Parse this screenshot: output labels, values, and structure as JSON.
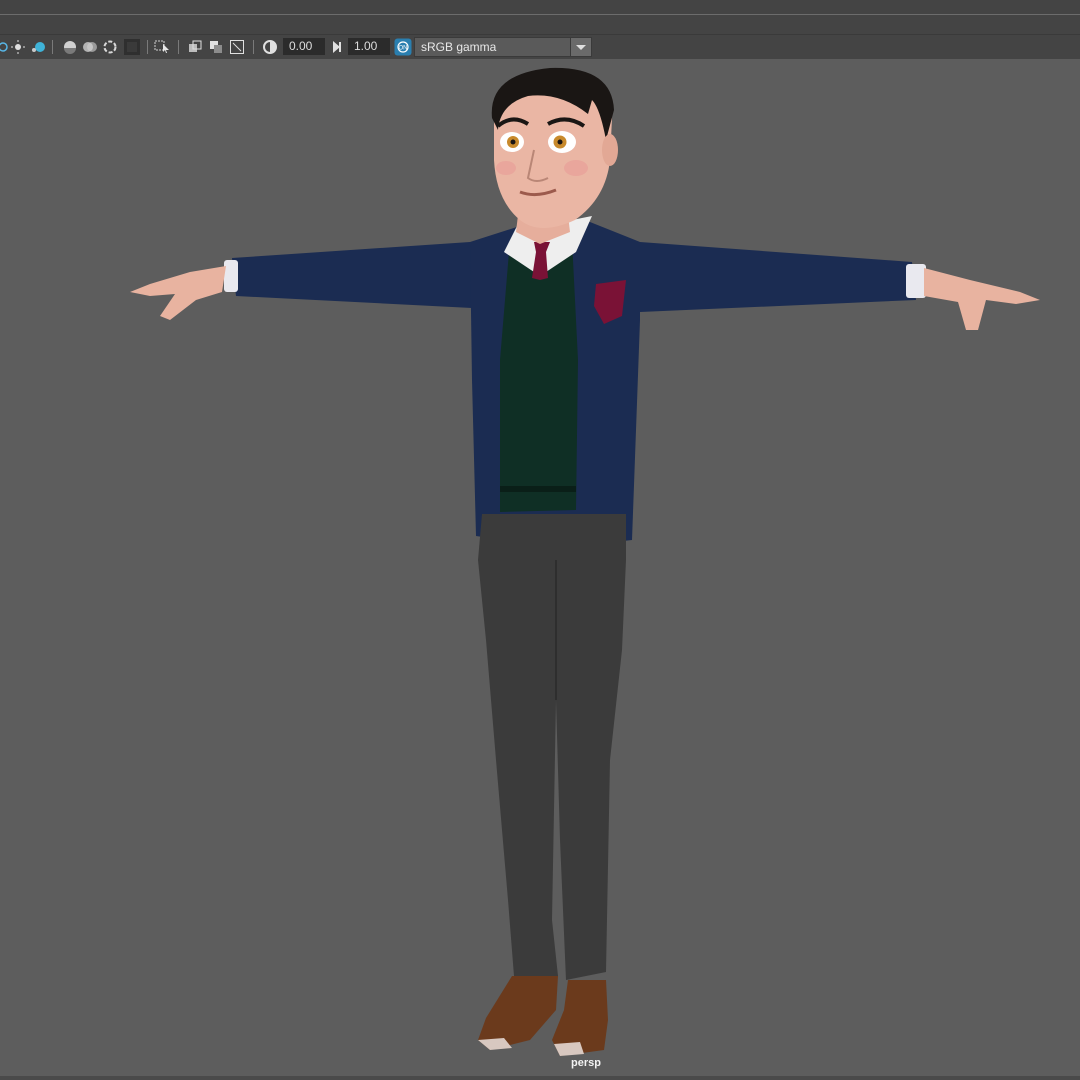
{
  "toolbar": {
    "exposure_value": "0.00",
    "gamma_value": "1.00",
    "color_space": "sRGB gamma",
    "icons": [
      "display-mode-icon",
      "light-icon",
      "shadow-icon",
      "ambient-occlusion-icon",
      "motion-blur-icon",
      "antialias-icon",
      "isolate-select-icon",
      "xray-icon",
      "xray-joints-icon",
      "xray-components-icon",
      "resolution-gate-icon",
      "exposure-icon",
      "gamma-icon",
      "color-management-icon",
      "colorspace-dropdown-icon"
    ]
  },
  "viewport": {
    "camera_label": "persp",
    "background_color": "#5d5d5d"
  },
  "scene": {
    "subject": "cartoon-character-t-pose",
    "colors": {
      "jacket": "#1b2c52",
      "sweater": "#0f2f25",
      "tie": "#7a1236",
      "pants": "#3b3b3b",
      "shoes": "#6b3a1c",
      "skin": "#e8b3a0",
      "hair": "#1a1614"
    }
  }
}
